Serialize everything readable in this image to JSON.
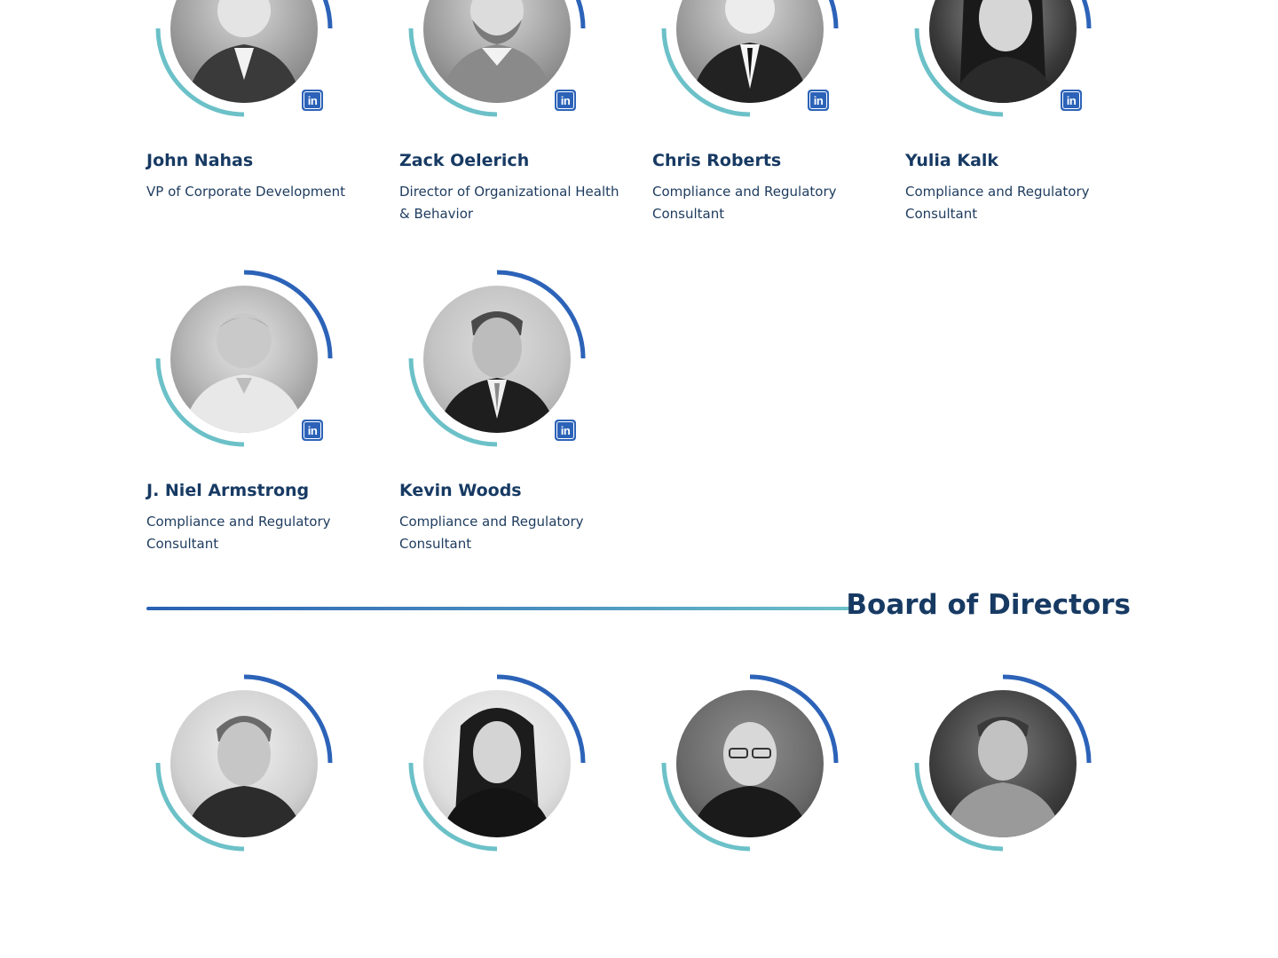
{
  "colors": {
    "ring_outer": "#2c63b8",
    "ring_inner": "#6cc1c8",
    "linkedin": "#2c63b8",
    "heading": "#173a63",
    "text": "#1d3b5e"
  },
  "icons": {
    "linkedin": "linkedin-icon",
    "linkedin_glyph": "in"
  },
  "team": [
    {
      "name": "John Nahas",
      "role": "VP of Corporate Development"
    },
    {
      "name": "Zack Oelerich",
      "role": "Director of Organizational Health & Behavior"
    },
    {
      "name": "Chris Roberts",
      "role": "Compliance and Regulatory Consultant"
    },
    {
      "name": "Yulia Kalk",
      "role": "Compliance and Regulatory Consultant"
    },
    {
      "name": "J. Niel Armstrong",
      "role": "Compliance and Regulatory Consultant"
    },
    {
      "name": "Kevin Woods",
      "role": "Compliance and Regulatory Consultant"
    }
  ],
  "board_section": {
    "title": "Board of Directors"
  },
  "board": [
    {
      "name": "",
      "role": ""
    },
    {
      "name": "",
      "role": ""
    },
    {
      "name": "",
      "role": ""
    },
    {
      "name": "",
      "role": ""
    }
  ]
}
